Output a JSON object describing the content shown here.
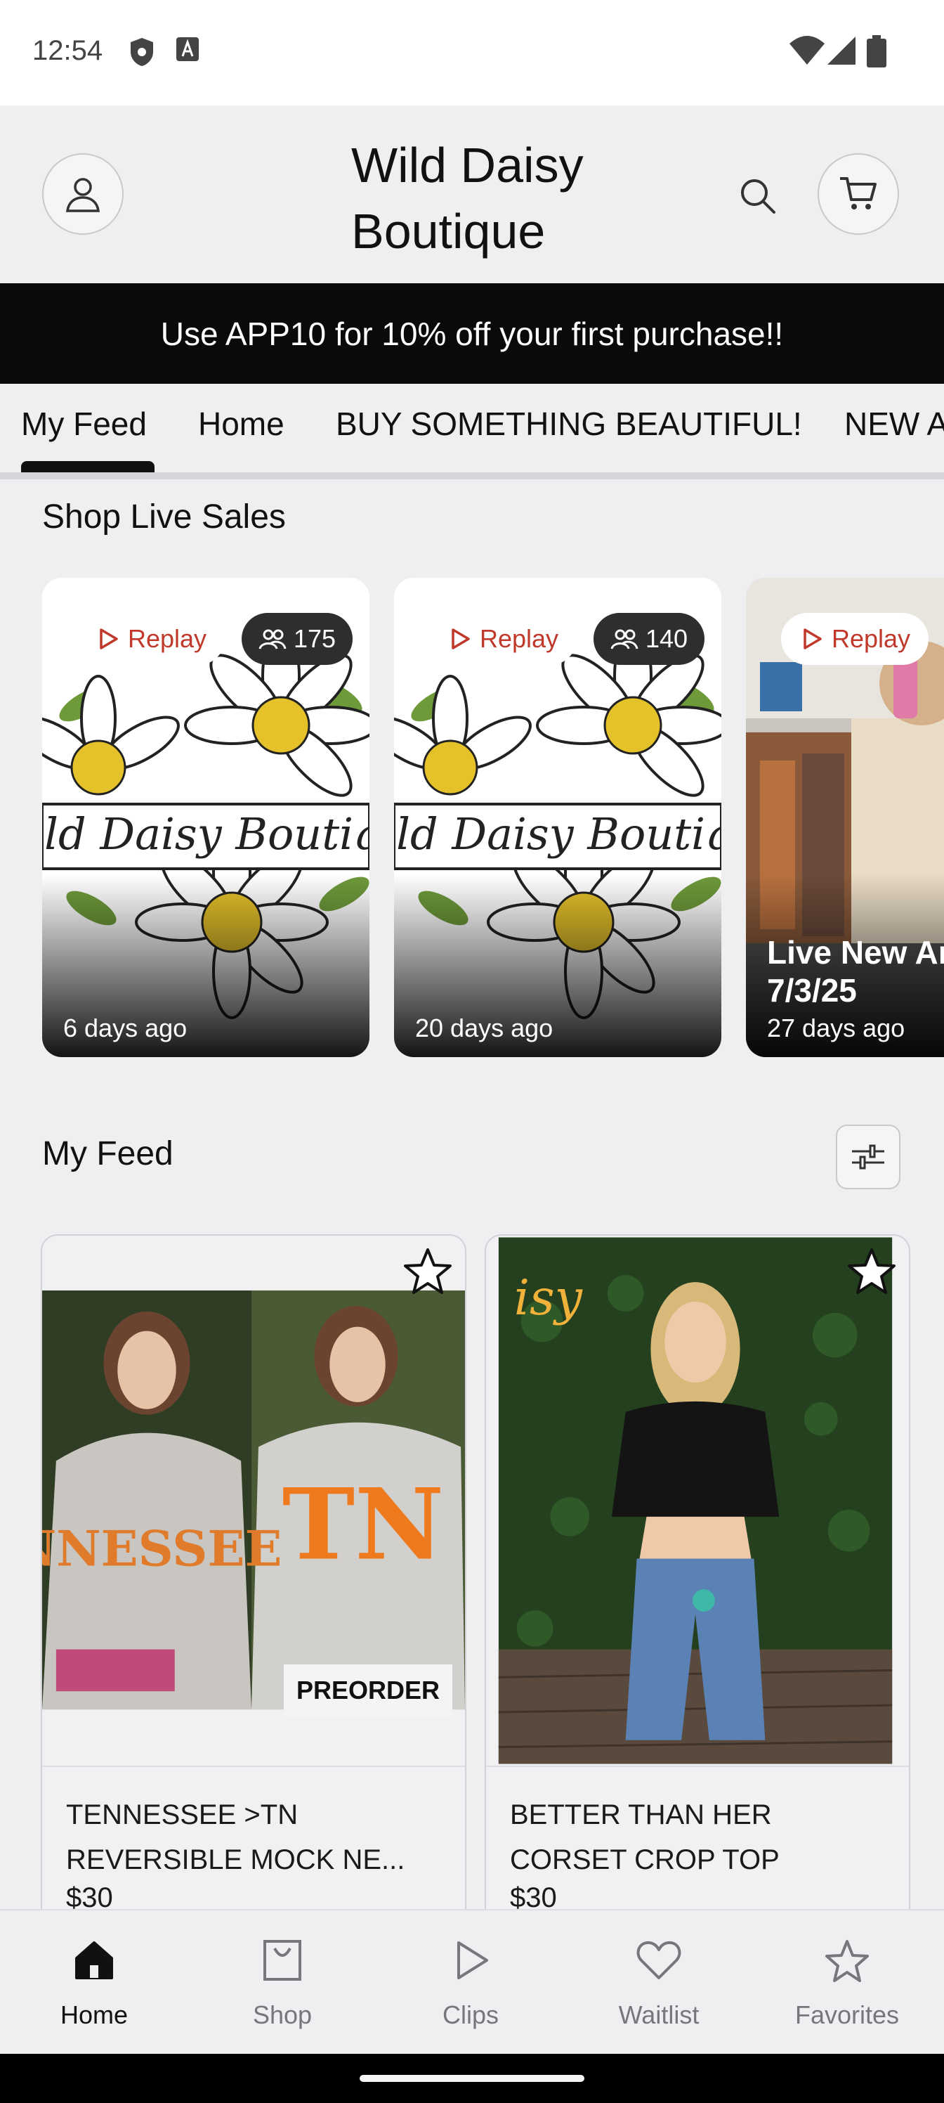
{
  "status_bar": {
    "time": "12:54"
  },
  "header": {
    "brand": "Wild Daisy Boutique"
  },
  "promo": {
    "text": "Use APP10 for 10% off your first purchase!!"
  },
  "tabs": [
    {
      "label": "My Feed",
      "active": true
    },
    {
      "label": "Home"
    },
    {
      "label": "BUY SOMETHING BEAUTIFUL!"
    },
    {
      "label": "NEW A"
    }
  ],
  "live_sales": {
    "title": "Shop Live Sales",
    "cards": [
      {
        "replay": "Replay",
        "viewers": "175",
        "ago": "6 days ago",
        "logo_text": "ild Daisy Boutiq"
      },
      {
        "replay": "Replay",
        "viewers": "140",
        "ago": "20 days ago",
        "logo_text": "ild Daisy Boutiq"
      },
      {
        "replay": "Replay",
        "title": "Live New Ar 7/3/25",
        "ago": "27 days ago"
      }
    ]
  },
  "feed": {
    "title": "My Feed",
    "products": [
      {
        "name": "TENNESSEE >TN REVERSIBLE MOCK NE...",
        "price": "$30",
        "badge": "PREORDER",
        "sweatshirt_text_1": "NNESSEE",
        "sweatshirt_text_2": "TN"
      },
      {
        "name": "BETTER THAN HER CORSET CROP TOP",
        "price": "$30",
        "neon_text": "isy"
      }
    ]
  },
  "bottom_nav": [
    {
      "label": "Home",
      "icon": "home-icon",
      "active": true
    },
    {
      "label": "Shop",
      "icon": "shopping-bag-icon"
    },
    {
      "label": "Clips",
      "icon": "play-icon"
    },
    {
      "label": "Waitlist",
      "icon": "heart-icon"
    },
    {
      "label": "Favorites",
      "icon": "star-icon"
    }
  ],
  "colors": {
    "replay_red": "#c0392b",
    "promo_bg": "#0a0a0a",
    "daisy_yellow": "#e5c12a"
  }
}
